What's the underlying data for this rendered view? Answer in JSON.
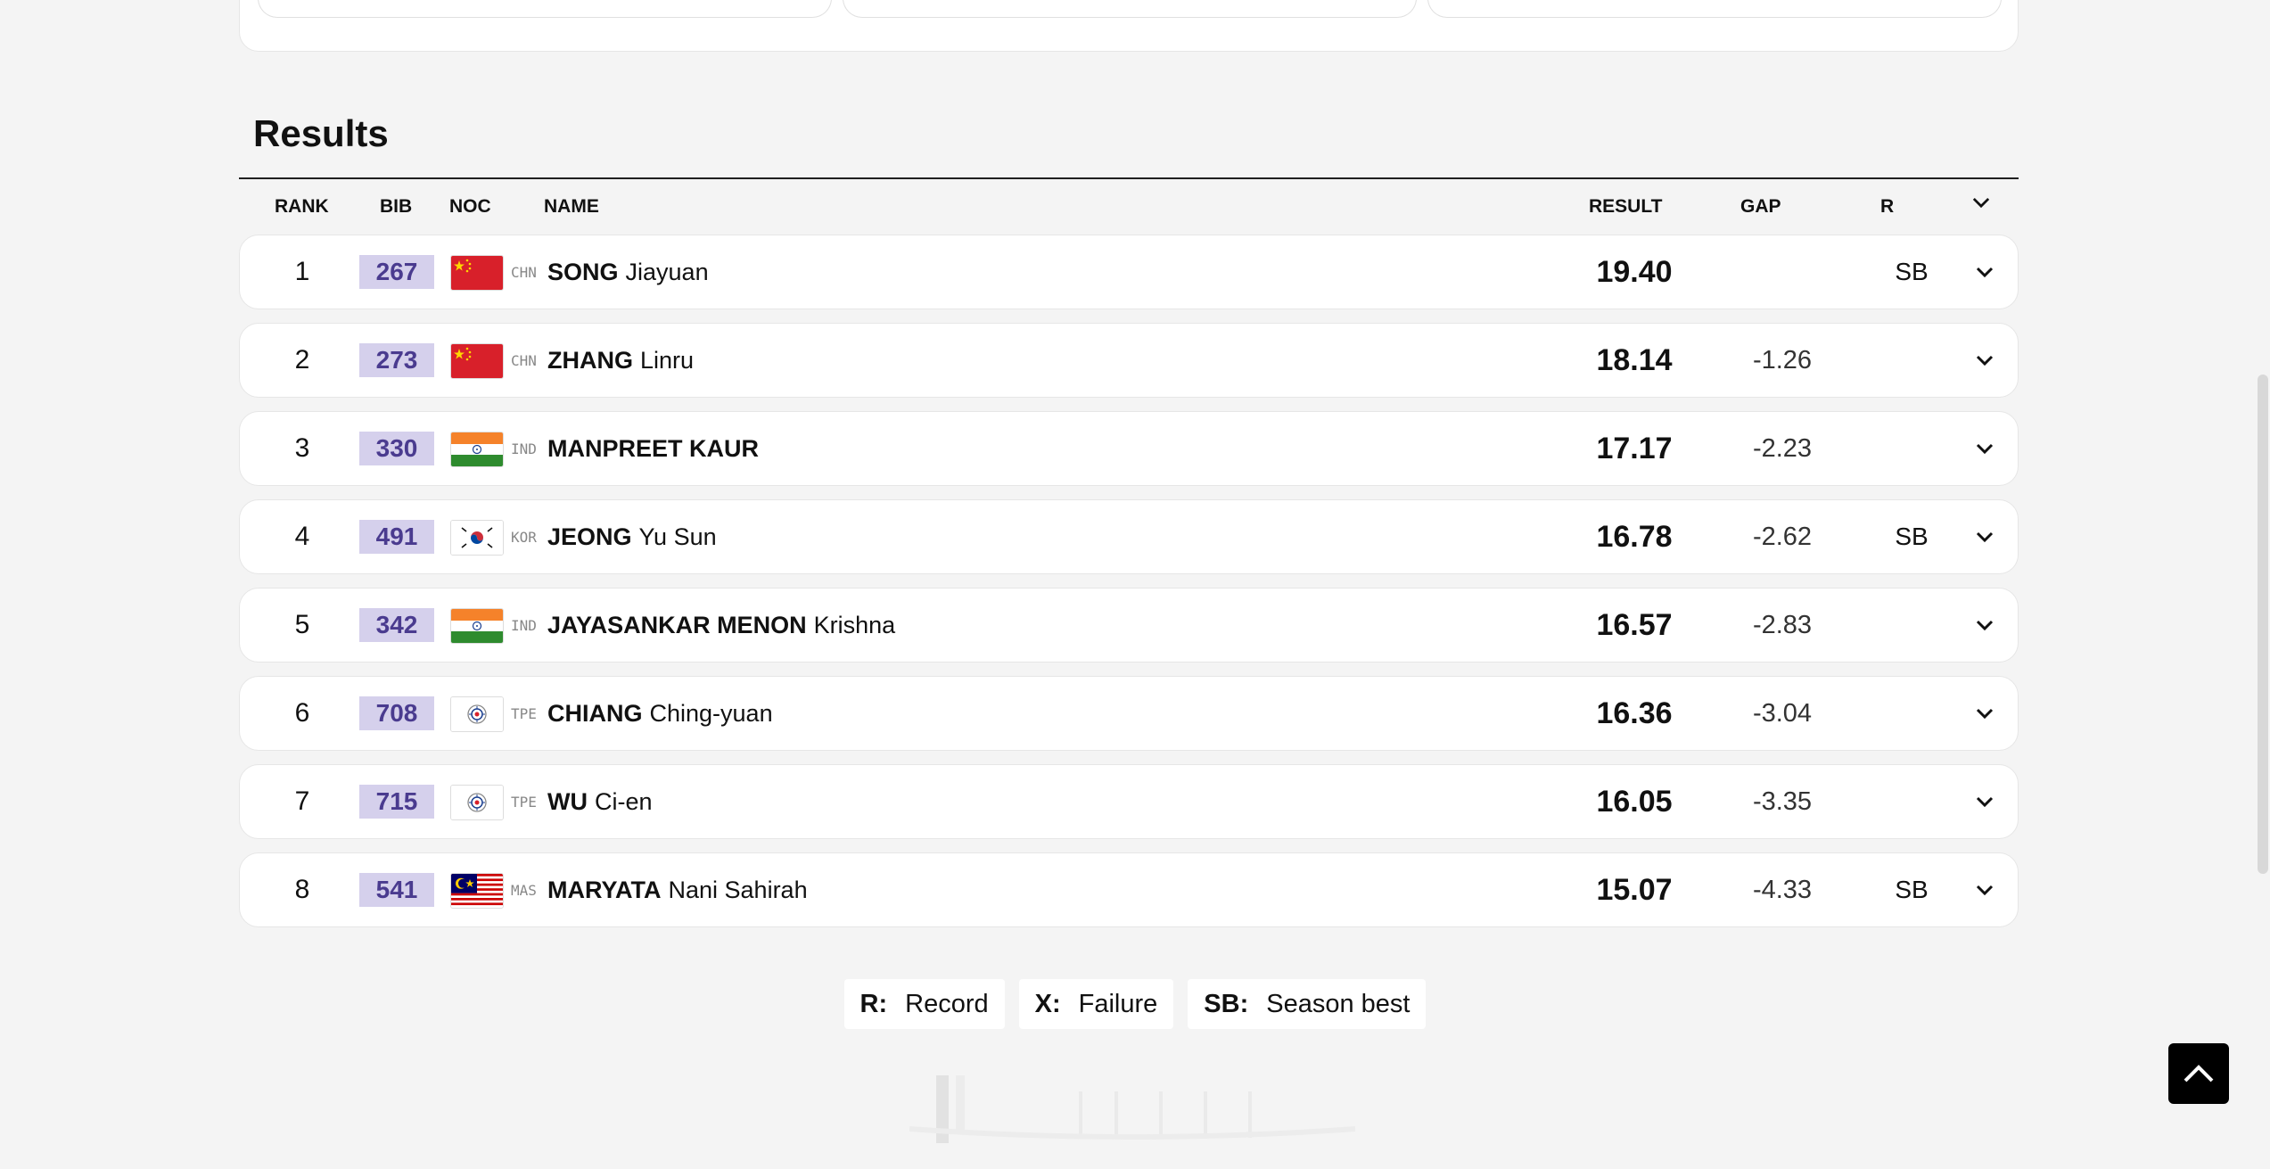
{
  "section": {
    "title": "Results"
  },
  "headers": {
    "rank": "RANK",
    "bib": "BIB",
    "noc": "NOC",
    "name": "NAME",
    "result": "RESULT",
    "gap": "GAP",
    "r": "R"
  },
  "rows": [
    {
      "rank": "1",
      "bib": "267",
      "noc": "CHN",
      "flag": "china-flag-icon",
      "last": "SONG",
      "first": "Jiayuan",
      "result": "19.40",
      "gap": "",
      "r": "SB"
    },
    {
      "rank": "2",
      "bib": "273",
      "noc": "CHN",
      "flag": "china-flag-icon",
      "last": "ZHANG",
      "first": "Linru",
      "result": "18.14",
      "gap": "-1.26",
      "r": ""
    },
    {
      "rank": "3",
      "bib": "330",
      "noc": "IND",
      "flag": "india-flag-icon",
      "last": "MANPREET KAUR",
      "first": "",
      "result": "17.17",
      "gap": "-2.23",
      "r": ""
    },
    {
      "rank": "4",
      "bib": "491",
      "noc": "KOR",
      "flag": "korea-flag-icon",
      "last": "JEONG",
      "first": "Yu Sun",
      "result": "16.78",
      "gap": "-2.62",
      "r": "SB"
    },
    {
      "rank": "5",
      "bib": "342",
      "noc": "IND",
      "flag": "india-flag-icon",
      "last": "JAYASANKAR MENON",
      "first": "Krishna",
      "result": "16.57",
      "gap": "-2.83",
      "r": ""
    },
    {
      "rank": "6",
      "bib": "708",
      "noc": "TPE",
      "flag": "chinese-taipei-flag-icon",
      "last": "CHIANG",
      "first": "Ching-yuan",
      "result": "16.36",
      "gap": "-3.04",
      "r": ""
    },
    {
      "rank": "7",
      "bib": "715",
      "noc": "TPE",
      "flag": "chinese-taipei-flag-icon",
      "last": "WU",
      "first": "Ci-en",
      "result": "16.05",
      "gap": "-3.35",
      "r": ""
    },
    {
      "rank": "8",
      "bib": "541",
      "noc": "MAS",
      "flag": "malaysia-flag-icon",
      "last": "MARYATA",
      "first": "Nani Sahirah",
      "result": "15.07",
      "gap": "-4.33",
      "r": "SB"
    }
  ],
  "legend": [
    {
      "key": "R:",
      "label": "Record"
    },
    {
      "key": "X:",
      "label": "Failure"
    },
    {
      "key": "SB:",
      "label": "Season best"
    }
  ],
  "colors": {
    "bib_bg": "#d5d0ec",
    "bib_text": "#4a3b8f",
    "accent": "#000000"
  },
  "icons": {
    "scroll_top": "chevron-up-icon",
    "expand": "chevron-down-icon"
  }
}
